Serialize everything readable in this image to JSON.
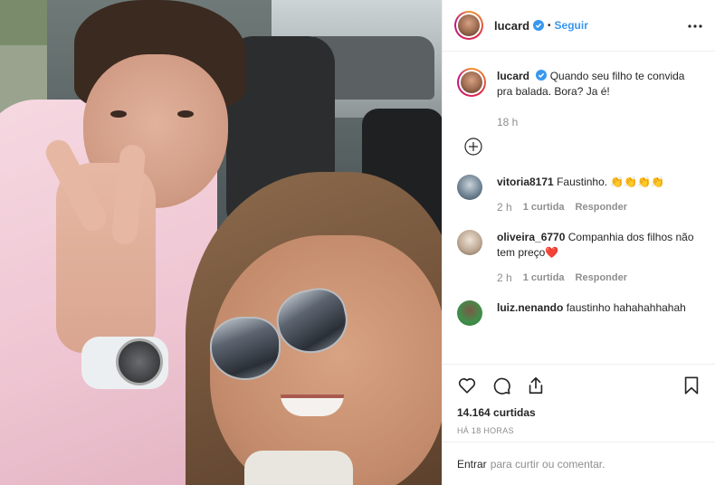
{
  "header": {
    "username": "lucard",
    "separator": "•",
    "follow_label": "Seguir"
  },
  "caption": {
    "username": "lucard",
    "text": "Quando seu filho te convida pra balada. Bora? Ja é!",
    "time": "18 h"
  },
  "comments": [
    {
      "username": "vitoria8171",
      "text": "Faustinho. 👏👏👏👏",
      "time": "2 h",
      "likes": "1 curtida",
      "reply": "Responder",
      "avatar_color": "#6b7f8f"
    },
    {
      "username": "oliveira_6770",
      "text": "Companhia dos filhos não tem preço❤️",
      "time": "2 h",
      "likes": "1 curtida",
      "reply": "Responder",
      "avatar_color": "#b9a38e"
    },
    {
      "username": "luiz.nenando",
      "text": "faustinho hahahahhahah",
      "time": "",
      "likes": "",
      "reply": "",
      "avatar_color": "#3f8f4a"
    }
  ],
  "actions": {
    "likes_count": "14.164 curtidas",
    "post_time": "HÁ 18 HORAS"
  },
  "comment_box": {
    "login_label": "Entrar",
    "placeholder": "para curtir ou comentar."
  },
  "colors": {
    "accent": "#3897f0",
    "text": "#262626",
    "muted": "#8e8e8e",
    "border": "#efefef"
  }
}
